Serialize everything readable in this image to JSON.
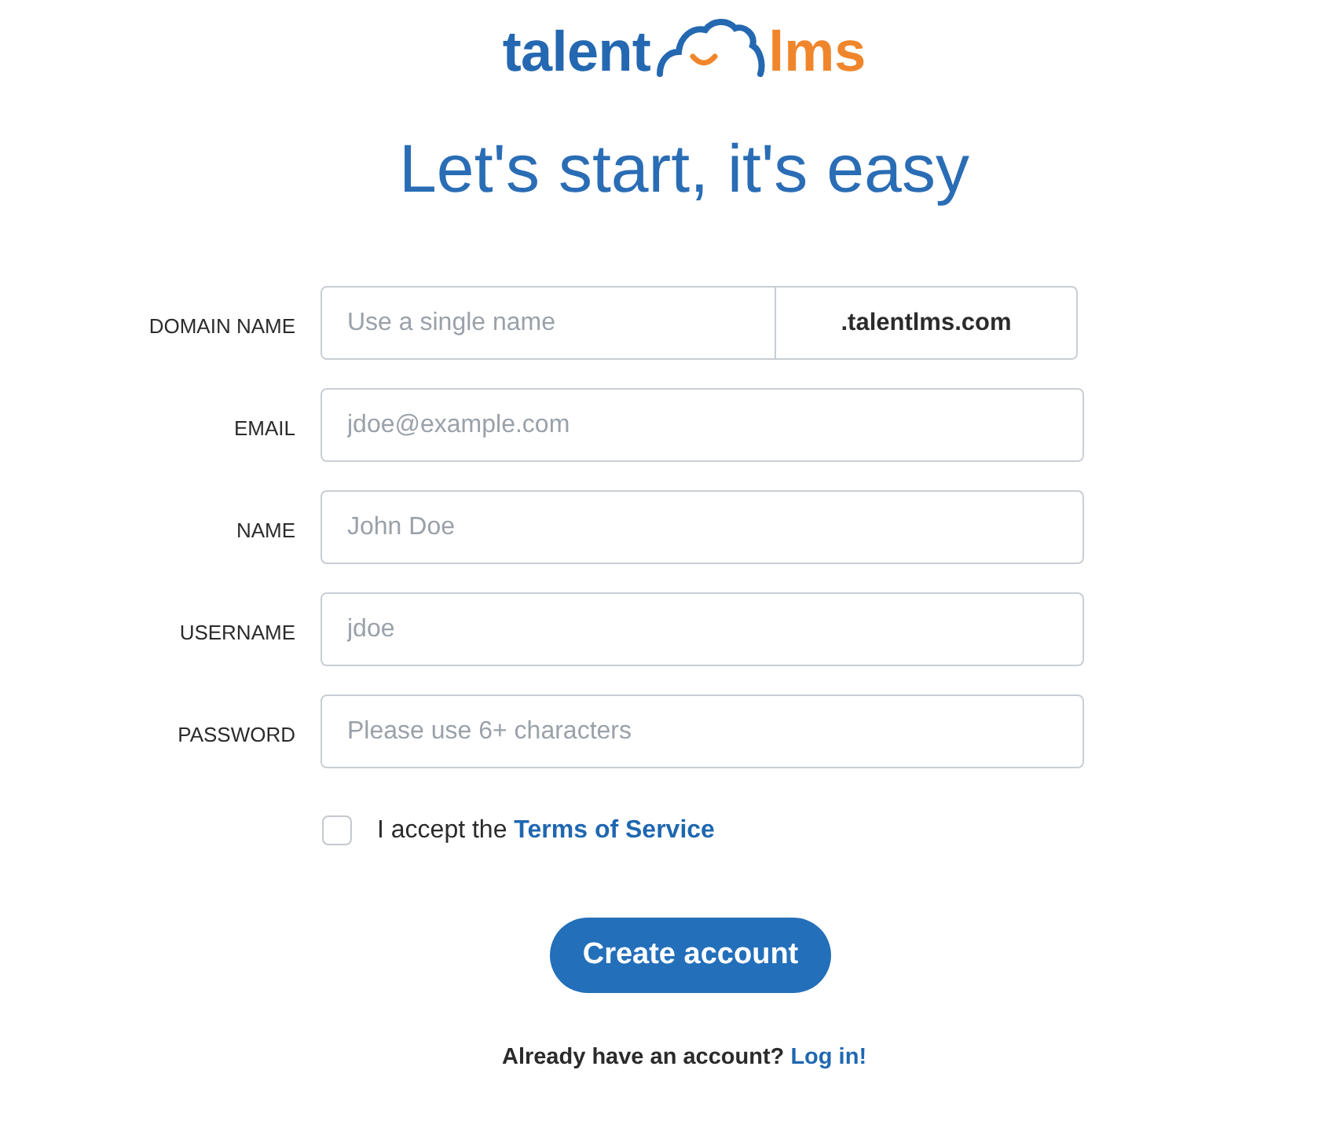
{
  "logo": {
    "left": "talent",
    "right": "lms"
  },
  "heading": "Let's start, it's easy",
  "fields": [
    {
      "kind": "suffixed",
      "label": "DOMAIN NAME",
      "placeholder": "Use a single name",
      "suffix": ".talentlms.com"
    },
    {
      "kind": "text",
      "label": "EMAIL",
      "placeholder": "jdoe@example.com"
    },
    {
      "kind": "text",
      "label": "NAME",
      "placeholder": "John Doe"
    },
    {
      "kind": "text",
      "label": "USERNAME",
      "placeholder": "jdoe"
    },
    {
      "kind": "password",
      "label": "PASSWORD",
      "placeholder": "Please use 6+ characters"
    }
  ],
  "terms": {
    "checked": false,
    "text": "I accept the",
    "link": "Terms of Service"
  },
  "button": "Create account",
  "footer": {
    "text": "Already have an account?",
    "link": "Log in!"
  }
}
